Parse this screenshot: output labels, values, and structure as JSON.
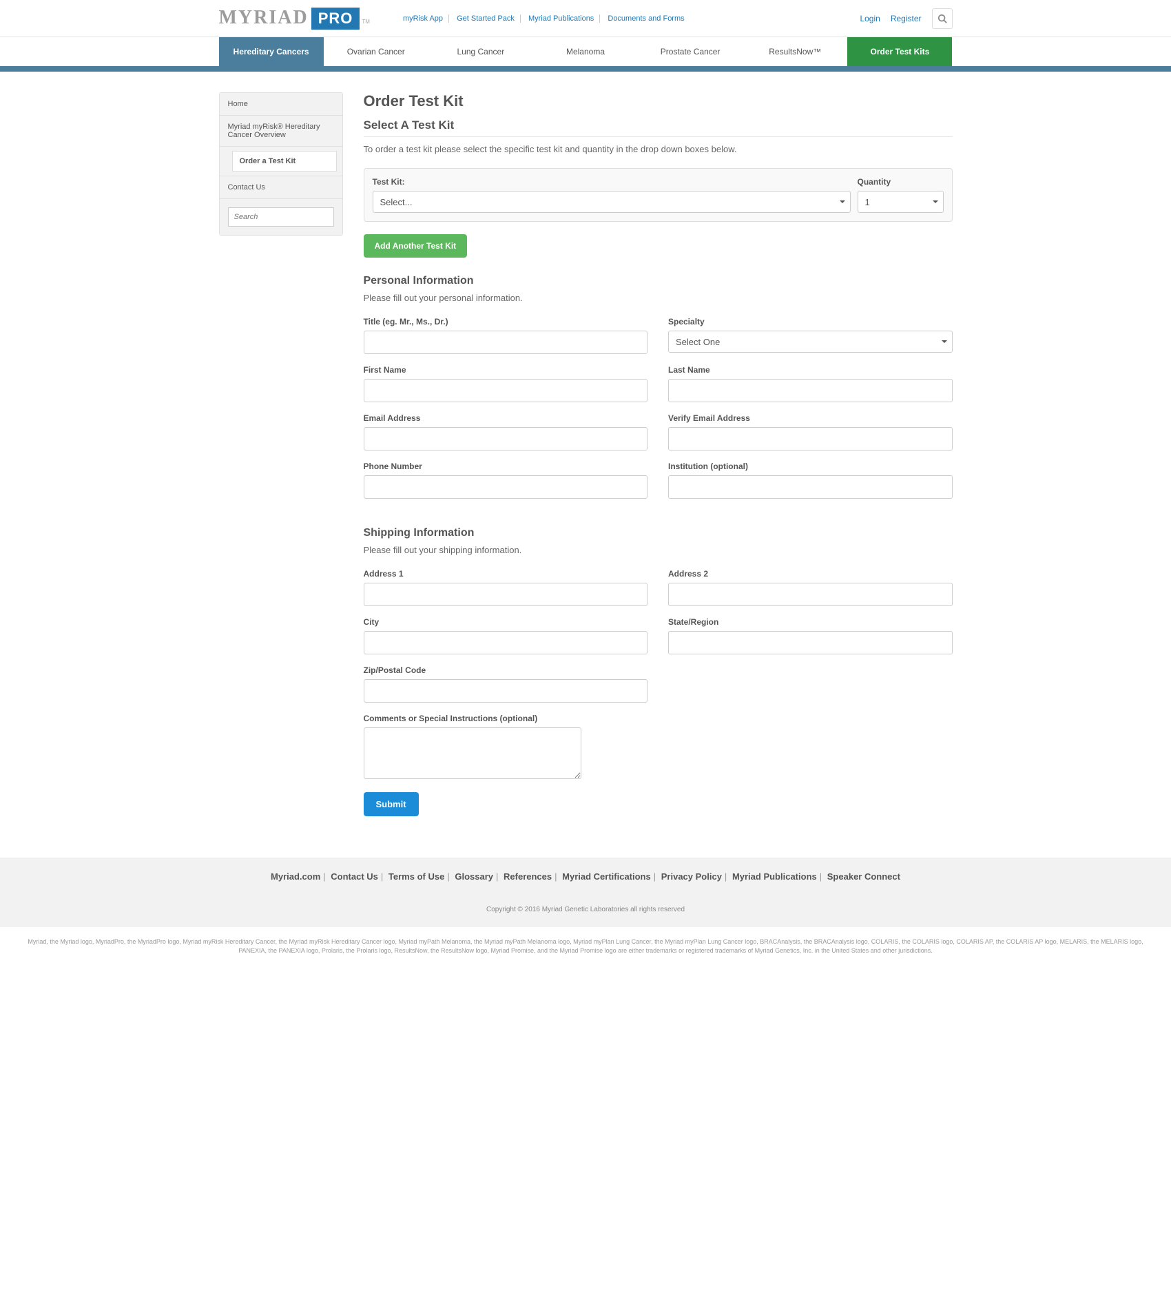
{
  "logo": {
    "part1": "MYRIAD",
    "part2": "PRO",
    "tm": "TM"
  },
  "topLinks": [
    "myRisk App",
    "Get Started Pack",
    "Myriad Publications",
    "Documents and Forms"
  ],
  "auth": {
    "login": "Login",
    "register": "Register"
  },
  "nav": [
    "Hereditary Cancers",
    "Ovarian Cancer",
    "Lung Cancer",
    "Melanoma",
    "Prostate Cancer",
    "ResultsNow™",
    "Order Test Kits"
  ],
  "sidebar": {
    "home": "Home",
    "overview": "Myriad myRisk® Hereditary Cancer Overview",
    "order": "Order a Test Kit",
    "contact": "Contact Us",
    "searchPlaceholder": "Search"
  },
  "page": {
    "title": "Order Test Kit",
    "section1": "Select A Test Kit",
    "desc1": "To order a test kit please select the specific test kit and quantity in the drop down boxes below.",
    "kitLabel": "Test Kit:",
    "kitValue": "Select...",
    "qtyLabel": "Quantity",
    "qtyValue": "1",
    "addBtn": "Add Another Test Kit",
    "section2": "Personal Information",
    "desc2": "Please fill out your personal information.",
    "section3": "Shipping Information",
    "desc3": "Please fill out your shipping information.",
    "submit": "Submit"
  },
  "fields": {
    "title": "Title (eg. Mr., Ms., Dr.)",
    "specialty": "Specialty",
    "specialtyVal": "Select One",
    "firstName": "First Name",
    "lastName": "Last Name",
    "email": "Email Address",
    "verifyEmail": "Verify Email Address",
    "phone": "Phone Number",
    "institution": "Institution (optional)",
    "addr1": "Address 1",
    "addr2": "Address 2",
    "city": "City",
    "state": "State/Region",
    "zip": "Zip/Postal Code",
    "comments": "Comments or Special Instructions (optional)"
  },
  "footer": {
    "links": [
      "Myriad.com",
      "Contact Us",
      "Terms of Use",
      "Glossary",
      "References",
      "Myriad Certifications",
      "Privacy Policy",
      "Myriad Publications",
      "Speaker Connect"
    ],
    "copyright": "Copyright © 2016 Myriad Genetic Laboratories all rights reserved",
    "legal": "Myriad, the Myriad logo, MyriadPro, the MyriadPro logo, Myriad myRisk Hereditary Cancer, the Myriad myRisk Hereditary Cancer logo, Myriad myPath Melanoma, the Myriad myPath Melanoma logo, Myriad myPlan Lung Cancer, the Myriad myPlan Lung Cancer logo, BRACAnalysis, the BRACAnalysis logo, COLARIS, the COLARIS logo, COLARIS AP, the COLARIS AP logo, MELARIS, the MELARIS logo, PANEXIA, the PANEXIA logo, Prolaris, the Prolaris logo, ResultsNow, the ResultsNow logo, Myriad Promise, and the Myriad Promise logo are either trademarks or registered trademarks of Myriad Genetics, Inc. in the United States and other jurisdictions."
  }
}
